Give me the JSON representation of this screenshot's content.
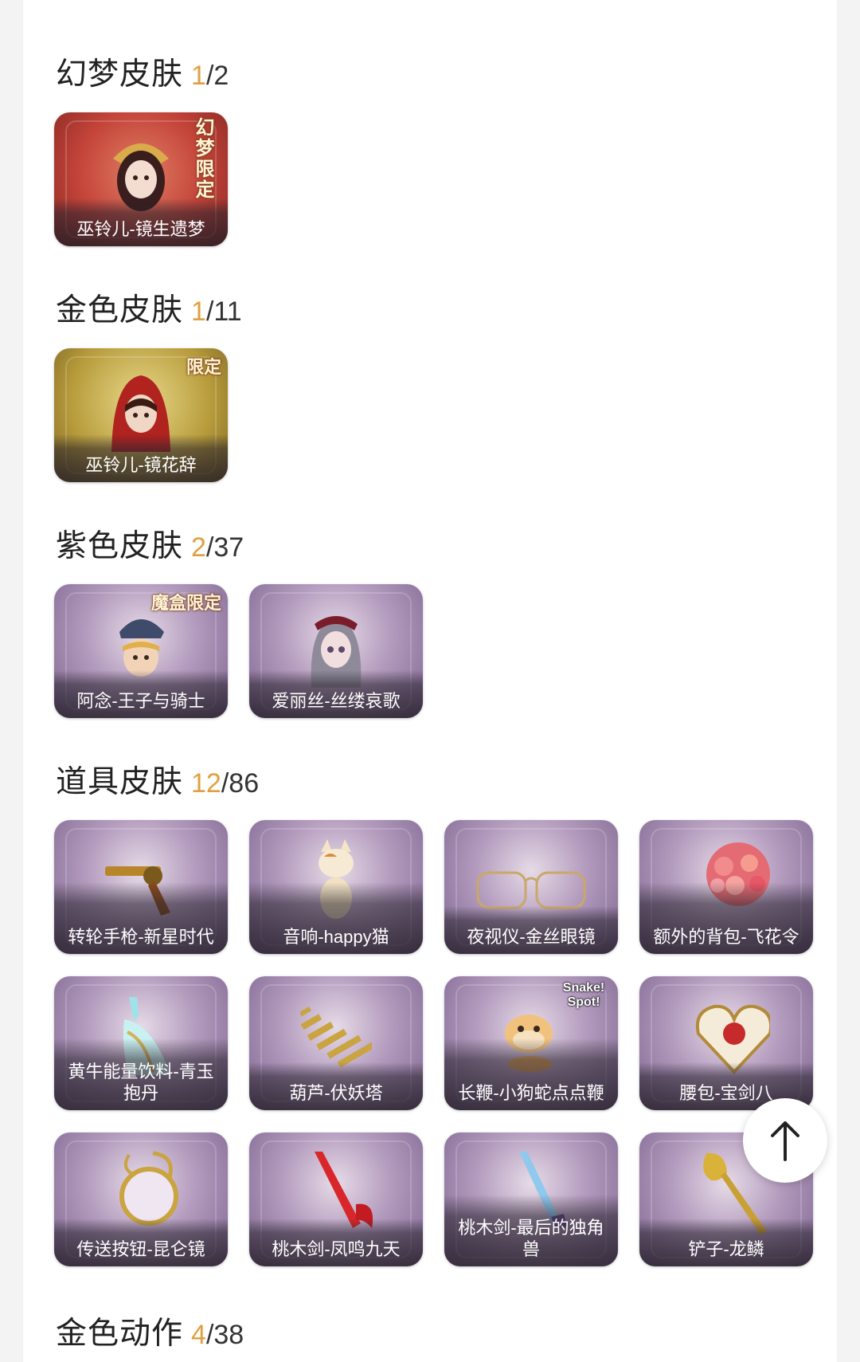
{
  "sections": [
    {
      "title": "幻梦皮肤",
      "owned": "1",
      "total": "/2",
      "items": [
        {
          "label": "巫铃儿-镜生遗梦",
          "badge": "幻梦限定"
        }
      ]
    },
    {
      "title": "金色皮肤",
      "owned": "1",
      "total": "/11",
      "items": [
        {
          "label": "巫铃儿-镜花辞",
          "badge": "限定"
        }
      ]
    },
    {
      "title": "紫色皮肤",
      "owned": "2",
      "total": "/37",
      "items": [
        {
          "label": "阿念-王子与骑士",
          "badge": "魔盒限定"
        },
        {
          "label": "爱丽丝-丝缕哀歌"
        }
      ]
    },
    {
      "title": "道具皮肤",
      "owned": "12",
      "total": "/86",
      "items": [
        {
          "label": "转轮手枪-新星时代"
        },
        {
          "label": "音响-happy猫"
        },
        {
          "label": "夜视仪-金丝眼镜"
        },
        {
          "label": "额外的背包-飞花令"
        },
        {
          "label": "黄牛能量饮料-青玉抱丹"
        },
        {
          "label": "葫芦-伏妖塔"
        },
        {
          "label": "长鞭-小狗蛇点点鞭",
          "badge": "Snake! Spot!"
        },
        {
          "label": "腰包-宝剑八"
        },
        {
          "label": "传送按钮-昆仑镜"
        },
        {
          "label": "桃木剑-凤鸣九天"
        },
        {
          "label": "桃木剑-最后的独角兽"
        },
        {
          "label": "铲子-龙鳞"
        }
      ]
    },
    {
      "title": "金色动作",
      "owned": "4",
      "total": "/38",
      "items": []
    }
  ],
  "scroll_top": {
    "icon": "arrow-up-icon"
  },
  "colors": {
    "count_owned": "#e0a041",
    "tile_dream": "#c4443a",
    "tile_gold": "#b79b3b",
    "tile_purple": "#9c83ab"
  }
}
